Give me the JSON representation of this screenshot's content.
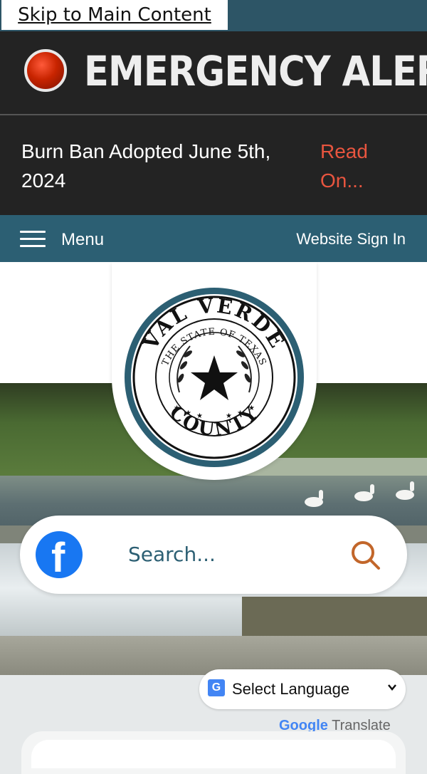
{
  "skip_link": "Skip to Main Content",
  "alert": {
    "title": "EMERGENCY ALERT",
    "message": "Burn Ban Adopted June 5th, 2024",
    "read_more": "Read On..."
  },
  "nav": {
    "menu_label": "Menu",
    "sign_in": "Website Sign In"
  },
  "logo": {
    "text_top": "VAL VERDE",
    "text_inner": "THE STATE OF TEXAS",
    "text_bottom": "COUNTY"
  },
  "search": {
    "placeholder": "Search..."
  },
  "translate": {
    "select_label": "Select Language",
    "powered_prefix": "Google",
    "powered_suffix": "Translate"
  },
  "colors": {
    "nav": "#2c5f73",
    "alert_bg": "#232323",
    "accent_red": "#e8553f",
    "search_icon": "#c2662a"
  },
  "icons": [
    "alert-light-icon",
    "menu-hamburger-icon",
    "facebook-icon",
    "search-icon",
    "google-translate-icon",
    "chevron-down-icon"
  ]
}
